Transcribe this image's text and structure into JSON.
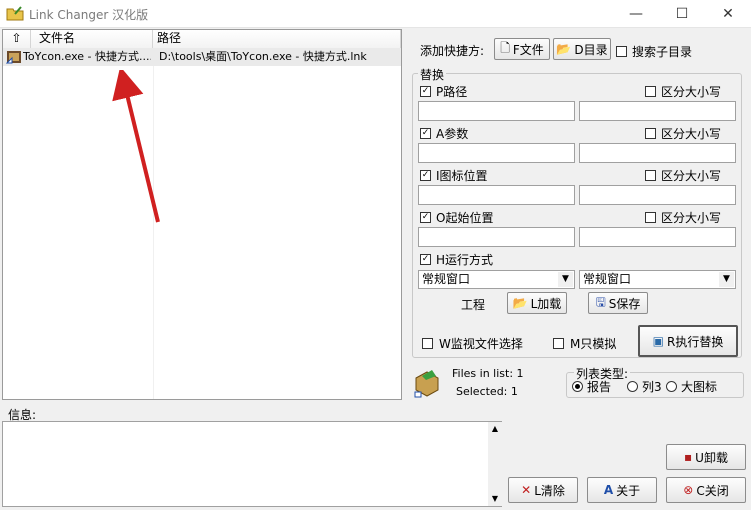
{
  "window": {
    "title": "Link Changer 汉化版",
    "controls": {
      "minimize": "—",
      "maximize": "☐",
      "close": "✕"
    }
  },
  "list": {
    "columns": [
      "文件名",
      "路径"
    ],
    "sort_icon": "up-arrow-icon",
    "rows": [
      {
        "name": "ToYcon.exe - 快捷方式....",
        "path": "D:\\tools\\桌面\\ToYcon.exe - 快捷方式.lnk"
      }
    ]
  },
  "add": {
    "label": "添加快捷方:",
    "file_button": "F文件",
    "dir_button": "D目录",
    "search_subdir": "搜索子目录"
  },
  "replace": {
    "legend": "替换",
    "case_label": "区分大小写",
    "rows": [
      {
        "label": "P路径"
      },
      {
        "label": "A参数"
      },
      {
        "label": "I图标位置"
      },
      {
        "label": "O起始位置"
      }
    ],
    "run_label": "H运行方式",
    "run_left": "常规窗口",
    "run_right": "常规窗口",
    "project_label": "工程",
    "load_button": "L加载",
    "save_button": "S保存"
  },
  "options": {
    "monitor": "W监视文件选择",
    "simulate": "M只模拟",
    "execute_button": "R执行替换"
  },
  "status": {
    "files_in_list": "Files in list: 1",
    "selected": "Selected: 1"
  },
  "listtype": {
    "legend": "列表类型:",
    "options": [
      "报告",
      "列3",
      "大图标"
    ]
  },
  "info": {
    "label": "信息:"
  },
  "buttons": {
    "uninstall": "U卸载",
    "clear": "L清除",
    "about": "关于",
    "close": "C关闭"
  }
}
